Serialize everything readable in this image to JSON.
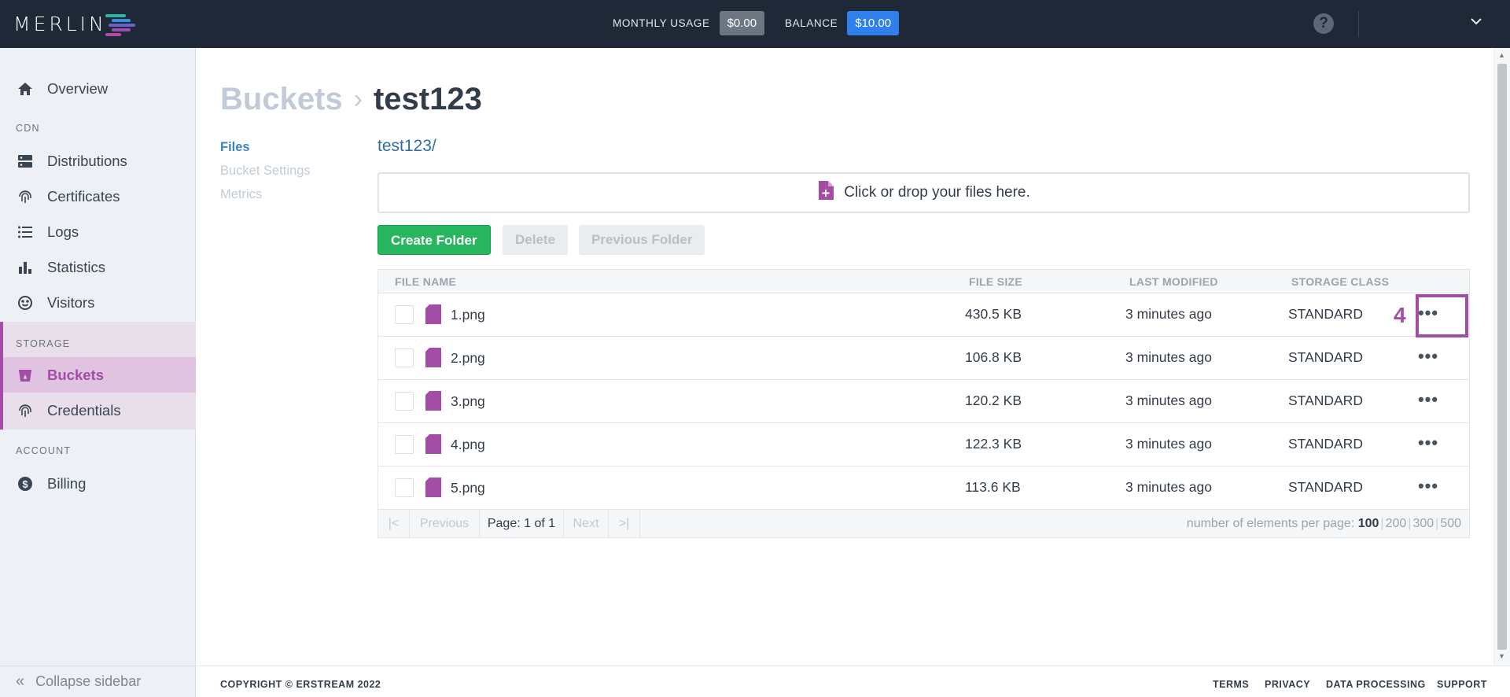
{
  "header": {
    "logo_text": "MERLIN",
    "monthly_usage_label": "MONTHLY USAGE",
    "monthly_usage_value": "$0.00",
    "balance_label": "BALANCE",
    "balance_value": "$10.00",
    "help_icon": "question-circle-icon",
    "menu_icon": "chevron-down-icon"
  },
  "sidebar": {
    "overview": "Overview",
    "cdn_section": "CDN",
    "distributions": "Distributions",
    "certificates": "Certificates",
    "logs": "Logs",
    "statistics": "Statistics",
    "visitors": "Visitors",
    "storage_section": "STORAGE",
    "buckets": "Buckets",
    "credentials": "Credentials",
    "account_section": "ACCOUNT",
    "billing": "Billing",
    "collapse": "Collapse sidebar",
    "active_item": "Buckets",
    "accent_color": "#a44da6"
  },
  "breadcrumb": {
    "parent": "Buckets",
    "separator": "›",
    "current": "test123"
  },
  "subnav": {
    "files": "Files",
    "bucket_settings": "Bucket Settings",
    "metrics": "Metrics"
  },
  "files": {
    "path": "test123/",
    "dropzone_text": "Click or drop your files here.",
    "create_folder": "Create Folder",
    "delete": "Delete",
    "previous_folder": "Previous Folder",
    "columns": {
      "name": "FILE NAME",
      "size": "FILE SIZE",
      "modified": "LAST MODIFIED",
      "class": "STORAGE CLASS"
    },
    "rows": [
      {
        "name": "1.png",
        "size": "430.5 KB",
        "modified": "3 minutes ago",
        "class": "STANDARD",
        "more": "•••"
      },
      {
        "name": "2.png",
        "size": "106.8 KB",
        "modified": "3 minutes ago",
        "class": "STANDARD",
        "more": "•••"
      },
      {
        "name": "3.png",
        "size": "120.2 KB",
        "modified": "3 minutes ago",
        "class": "STANDARD",
        "more": "•••"
      },
      {
        "name": "4.png",
        "size": "122.3 KB",
        "modified": "3 minutes ago",
        "class": "STANDARD",
        "more": "•••"
      },
      {
        "name": "5.png",
        "size": "113.6 KB",
        "modified": "3 minutes ago",
        "class": "STANDARD",
        "more": "•••"
      }
    ],
    "marker": "4"
  },
  "pagination": {
    "first": "|<",
    "previous": "Previous",
    "page": "Page: 1 of 1",
    "next": "Next",
    "last": ">|",
    "per_page_label": "number of elements per page:",
    "per_page_options": [
      "100",
      "200",
      "300",
      "500"
    ],
    "per_page_selected": "100"
  },
  "footer": {
    "copyright": "COPYRIGHT © ERSTREAM 2022",
    "terms": "TERMS",
    "privacy": "PRIVACY",
    "data_processing": "DATA PROCESSING",
    "support": "SUPPORT"
  }
}
